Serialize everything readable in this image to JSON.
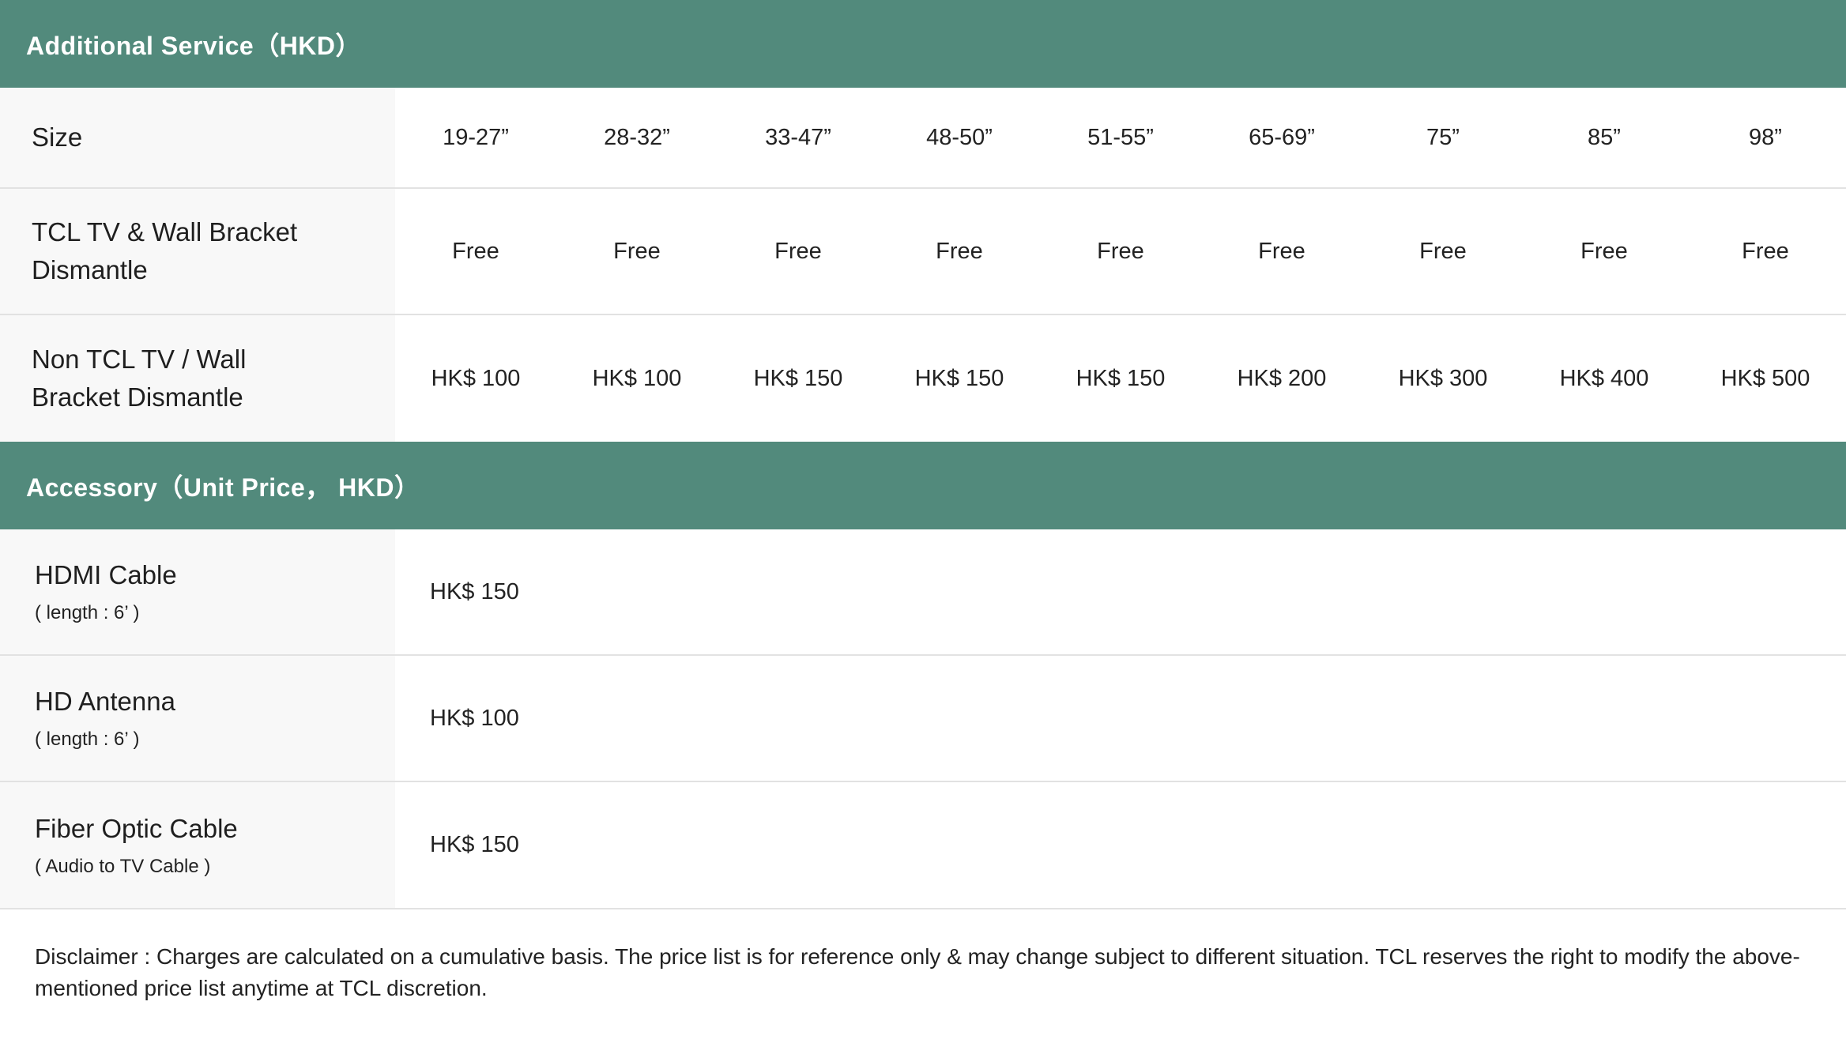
{
  "service": {
    "title": "Additional Service（HKD）",
    "size_label": "Size",
    "sizes": [
      "19-27”",
      "28-32”",
      "33-47”",
      "48-50”",
      "51-55”",
      "65-69”",
      "75”",
      "85”",
      "98”"
    ],
    "rows": [
      {
        "label": "TCL TV & Wall Bracket Dismantle",
        "prices": [
          "Free",
          "Free",
          "Free",
          "Free",
          "Free",
          "Free",
          "Free",
          "Free",
          "Free"
        ]
      },
      {
        "label": "Non TCL TV / Wall Bracket Dismantle",
        "prices": [
          "HK$ 100",
          "HK$ 100",
          "HK$ 150",
          "HK$ 150",
          "HK$ 150",
          "HK$ 200",
          "HK$ 300",
          "HK$ 400",
          "HK$ 500"
        ]
      }
    ]
  },
  "accessory": {
    "title": "Accessory（Unit Price， HKD）",
    "items": [
      {
        "name": "HDMI Cable",
        "note": "( length : 6’ )",
        "price": "HK$ 150"
      },
      {
        "name": "HD Antenna",
        "note": "( length : 6’ )",
        "price": "HK$ 100"
      },
      {
        "name": "Fiber Optic Cable",
        "note": "( Audio to TV Cable )",
        "price": "HK$ 150"
      }
    ]
  },
  "disclaimer": "Disclaimer : Charges are calculated on a cumulative basis. The price list is for reference only & may change subject to different situation. TCL reserves the right to modify the above-mentioned price list anytime at TCL discretion.",
  "colors": {
    "header_bg": "#528a7c",
    "label_bg": "#f8f8f8",
    "divider": "#e2e2e2"
  }
}
